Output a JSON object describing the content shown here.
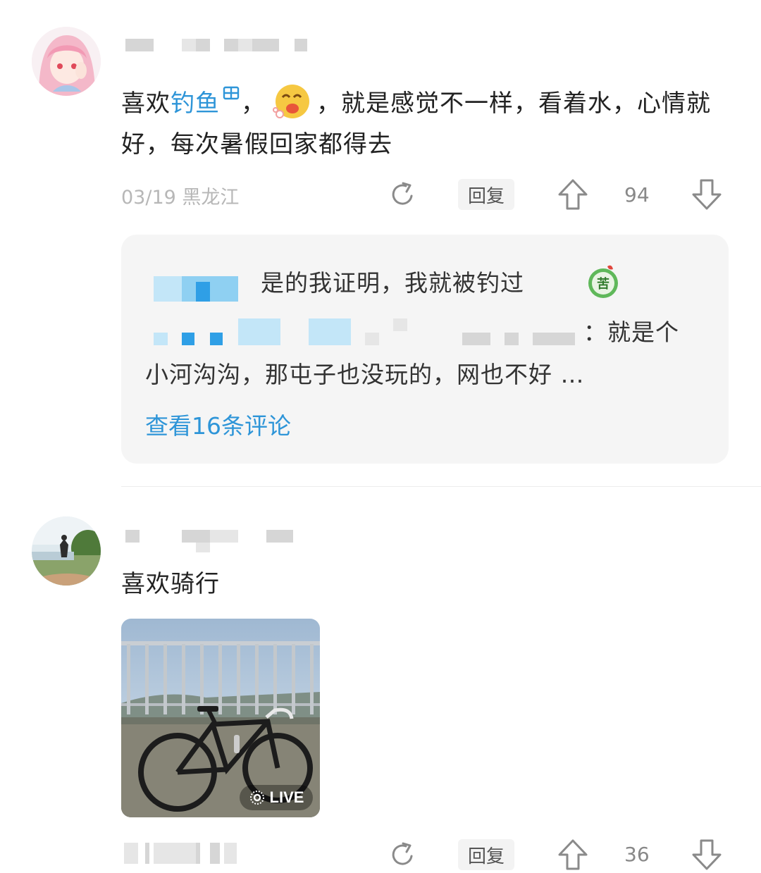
{
  "comment1": {
    "text_before": "喜欢",
    "link_text": "钓鱼",
    "link_icon": "search-grid-icon",
    "text_after_link": "，",
    "emoji": "drooling-face-emoji",
    "text_main": "，就是感觉不一样，看着水，心情就好，每次暑假回家都得去",
    "meta": "03/19 黑龙江",
    "reply_label": "回复",
    "like_count": "94",
    "replies": {
      "first_reply_text": "是的我证明，我就被钓过",
      "first_reply_emoji": "bitter-face-emoji",
      "second_reply_tail": "：就是个",
      "second_reply_line2": "小河沟沟，那屯子也没玩的，网也不好",
      "ellipsis": "…",
      "view_more": "查看16条评论"
    }
  },
  "comment2": {
    "text": "喜欢骑行",
    "image_badge": "LIVE",
    "reply_label": "回复",
    "like_count": "36"
  },
  "colors": {
    "link": "#2e95d8",
    "meta": "#b7b7b7",
    "subbox_bg": "#f5f5f5"
  }
}
